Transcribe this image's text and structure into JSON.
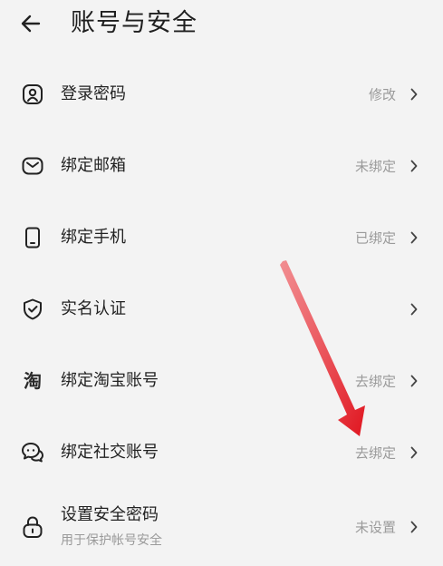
{
  "header": {
    "back_icon": "arrow-left-icon",
    "title": "账号与安全"
  },
  "items": [
    {
      "id": "login-password",
      "icon": "user-badge-icon",
      "label": "登录密码",
      "status": "修改"
    },
    {
      "id": "bind-email",
      "icon": "envelope-icon",
      "label": "绑定邮箱",
      "status": "未绑定"
    },
    {
      "id": "bind-phone",
      "icon": "phone-icon",
      "label": "绑定手机",
      "status": "已绑定"
    },
    {
      "id": "real-name",
      "icon": "shield-check-icon",
      "label": "实名认证",
      "status": ""
    },
    {
      "id": "bind-taobao",
      "icon": "taobao-icon",
      "icon_glyph": "淘",
      "label": "绑定淘宝账号",
      "status": "去绑定"
    },
    {
      "id": "bind-social",
      "icon": "chat-bubbles-icon",
      "label": "绑定社交账号",
      "status": "去绑定"
    },
    {
      "id": "security-password",
      "icon": "lock-icon",
      "label": "设置安全密码",
      "sublabel": "用于保护帐号安全",
      "status": "未设置"
    }
  ],
  "colors": {
    "background": "#f3f3f3",
    "text_primary": "#222222",
    "text_secondary": "#9a9a9a",
    "annotation_arrow": "#e8202a"
  }
}
